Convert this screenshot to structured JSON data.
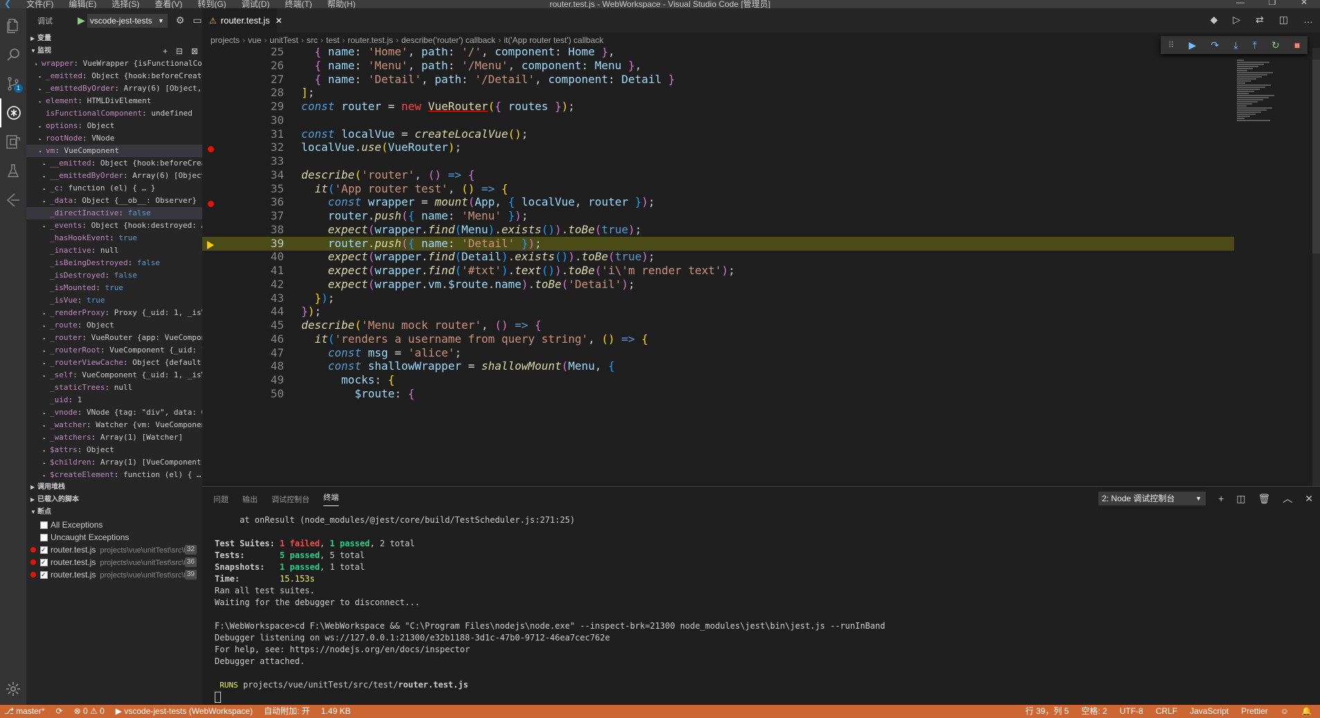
{
  "titlebar": {
    "menus": [
      "文件(F)",
      "编辑(E)",
      "选择(S)",
      "查看(V)",
      "转到(G)",
      "调试(D)",
      "终端(T)",
      "帮助(H)"
    ],
    "title": "router.test.js - WebWorkspace - Visual Studio Code [管理员]"
  },
  "activity": {
    "badge": "1"
  },
  "debug": {
    "label": "调试",
    "config": "vscode-jest-tests"
  },
  "sidebar": {
    "sec_variables": "变量",
    "sec_watch": "监视",
    "sec_callstack": "调用堆栈",
    "sec_scripts": "已载入的脚本",
    "sec_breakpoints": "断点",
    "watch": [
      {
        "t": "▾",
        "ind": 0,
        "k": "wrapper",
        "v": "VueWrapper {isFunctionalCompo…",
        "c": "v"
      },
      {
        "t": "▸",
        "ind": 1,
        "k": "_emitted",
        "v": "Object {hook:beforeCreate: …",
        "c": "v"
      },
      {
        "t": "▸",
        "ind": 1,
        "k": "_emittedByOrder",
        "v": "Array(6) [Object, Ob…",
        "c": "v"
      },
      {
        "t": "▸",
        "ind": 1,
        "k": "element",
        "v": "HTMLDivElement",
        "c": "v"
      },
      {
        "t": "",
        "ind": 1,
        "k": "isFunctionalComponent",
        "v": "undefined",
        "c": "v"
      },
      {
        "t": "▸",
        "ind": 1,
        "k": "options",
        "v": "Object",
        "c": "v"
      },
      {
        "t": "▸",
        "ind": 1,
        "k": "rootNode",
        "v": "VNode",
        "c": "v"
      },
      {
        "t": "▾",
        "ind": 1,
        "k": "vm",
        "v": "VueComponent",
        "c": "v",
        "sel": "vm"
      },
      {
        "t": "▸",
        "ind": 2,
        "k": "__emitted",
        "v": "Object {hook:beforeCreat…",
        "c": "v"
      },
      {
        "t": "▸",
        "ind": 2,
        "k": "__emittedByOrder",
        "v": "Array(6) [Object,…",
        "c": "v"
      },
      {
        "t": "▸",
        "ind": 2,
        "k": "_c",
        "v": "function (el) { … }",
        "c": "v"
      },
      {
        "t": "▸",
        "ind": 2,
        "k": "_data",
        "v": "Object {__ob__: Observer}",
        "c": "v"
      },
      {
        "t": "",
        "ind": 2,
        "k": "_directInactive",
        "v": "false",
        "c": "vb",
        "sel": "hl"
      },
      {
        "t": "▸",
        "ind": 2,
        "k": "_events",
        "v": "Object {hook:destroyed: Ar…",
        "c": "v"
      },
      {
        "t": "",
        "ind": 2,
        "k": "_hasHookEvent",
        "v": "true",
        "c": "vb"
      },
      {
        "t": "",
        "ind": 2,
        "k": "_inactive",
        "v": "null",
        "c": "v"
      },
      {
        "t": "",
        "ind": 2,
        "k": "_isBeingDestroyed",
        "v": "false",
        "c": "vb"
      },
      {
        "t": "",
        "ind": 2,
        "k": "_isDestroyed",
        "v": "false",
        "c": "vb"
      },
      {
        "t": "",
        "ind": 2,
        "k": "_isMounted",
        "v": "true",
        "c": "vb"
      },
      {
        "t": "",
        "ind": 2,
        "k": "_isVue",
        "v": "true",
        "c": "vb"
      },
      {
        "t": "▸",
        "ind": 2,
        "k": "_renderProxy",
        "v": "Proxy {_uid: 1, _isVu…",
        "c": "v"
      },
      {
        "t": "▸",
        "ind": 2,
        "k": "_route",
        "v": "Object",
        "c": "v"
      },
      {
        "t": "▸",
        "ind": 2,
        "k": "_router",
        "v": "VueRouter {app: VueCompone…",
        "c": "v"
      },
      {
        "t": "▸",
        "ind": 2,
        "k": "_routerRoot",
        "v": "VueComponent {_uid: 1,…",
        "c": "v"
      },
      {
        "t": "▸",
        "ind": 2,
        "k": "_routerViewCache",
        "v": "Object {default: …",
        "c": "v"
      },
      {
        "t": "▸",
        "ind": 2,
        "k": "_self",
        "v": "VueComponent {_uid: 1, _isVu…",
        "c": "v"
      },
      {
        "t": "",
        "ind": 2,
        "k": "_staticTrees",
        "v": "null",
        "c": "v"
      },
      {
        "t": "",
        "ind": 2,
        "k": "_uid",
        "v": "1",
        "c": "vn"
      },
      {
        "t": "▸",
        "ind": 2,
        "k": "_vnode",
        "v": "VNode {tag: \"div\", data: Ob…",
        "c": "v"
      },
      {
        "t": "▸",
        "ind": 2,
        "k": "_watcher",
        "v": "Watcher {vm: VueComponent…",
        "c": "v"
      },
      {
        "t": "▸",
        "ind": 2,
        "k": "_watchers",
        "v": "Array(1) [Watcher]",
        "c": "v"
      },
      {
        "t": "▸",
        "ind": 2,
        "k": "$attrs",
        "v": "Object",
        "c": "v"
      },
      {
        "t": "▸",
        "ind": 2,
        "k": "$children",
        "v": "Array(1) [VueComponent]",
        "c": "v"
      },
      {
        "t": "▸",
        "ind": 2,
        "k": "$createElement",
        "v": "function (el) { … }",
        "c": "v"
      }
    ],
    "breakpoints": [
      {
        "label": "All Exceptions",
        "checked": false
      },
      {
        "label": "Uncaught Exceptions",
        "checked": false
      },
      {
        "label": "router.test.js",
        "path": "projects\\vue\\unitTest\\src\\t…",
        "line": "32",
        "checked": true
      },
      {
        "label": "router.test.js",
        "path": "projects\\vue\\unitTest\\src\\t…",
        "line": "36",
        "checked": true
      },
      {
        "label": "router.test.js",
        "path": "projects\\vue\\unitTest\\src\\t…",
        "line": "39",
        "checked": true
      }
    ]
  },
  "editor": {
    "tab_label": "router.test.js",
    "breadcrumb": [
      "projects",
      "vue",
      "unitTest",
      "src",
      "test",
      "router.test.js",
      "describe('router') callback",
      "it('App router test') callback"
    ],
    "lines": [
      {
        "n": "25",
        "h": "  <span class=\"pu\">{</span> <span class=\"var\">name</span>: <span class=\"str\">'Home'</span>, <span class=\"var\">path</span>: <span class=\"str\">'/'</span>, <span class=\"var\">component</span>: <span class=\"var\">Home</span> <span class=\"pu\">}</span>,"
      },
      {
        "n": "26",
        "h": "  <span class=\"pu\">{</span> <span class=\"var\">name</span>: <span class=\"str\">'Menu'</span>, <span class=\"var\">path</span>: <span class=\"str\">'/Menu'</span>, <span class=\"var\">component</span>: <span class=\"var\">Menu</span> <span class=\"pu\">}</span>,"
      },
      {
        "n": "27",
        "h": "  <span class=\"pu\">{</span> <span class=\"var\">name</span>: <span class=\"str\">'Detail'</span>, <span class=\"var\">path</span>: <span class=\"str\">'/Detail'</span>, <span class=\"var\">component</span>: <span class=\"var\">Detail</span> <span class=\"pu\">}</span>"
      },
      {
        "n": "28",
        "h": "<span class=\"bu\">]</span>;"
      },
      {
        "n": "29",
        "h": "<span class=\"kw\">const</span> <span class=\"var\">router</span> <span class=\"op\">=</span> <span class=\"new\">new</span> <span class=\"fnu\">VueRouter</span><span class=\"bu\">(</span><span class=\"pu\">{</span> <span class=\"var\">routes</span> <span class=\"pu\">}</span><span class=\"bu\">)</span>;"
      },
      {
        "n": "30",
        "h": ""
      },
      {
        "n": "31",
        "h": "<span class=\"kw\">const</span> <span class=\"var\">localVue</span> <span class=\"op\">=</span> <span class=\"fn\">createLocalVue</span><span class=\"bu\">()</span>;"
      },
      {
        "n": "32",
        "h": "<span class=\"var\">localVue</span>.<span class=\"fn\">use</span><span class=\"bu\">(</span><span class=\"var\">VueRouter</span><span class=\"bu\">)</span>;",
        "bp": true
      },
      {
        "n": "33",
        "h": ""
      },
      {
        "n": "34",
        "h": "<span class=\"fn\">describe</span><span class=\"bu\">(</span><span class=\"str\">'router'</span>, <span class=\"pu\">()</span> <span class=\"kw2\">=&gt;</span> <span class=\"pu\">{</span>"
      },
      {
        "n": "35",
        "h": "  <span class=\"fn\">it</span><span class=\"bl\">(</span><span class=\"str\">'App router test'</span>, <span class=\"bu\">()</span> <span class=\"kw2\">=&gt;</span> <span class=\"bu\">{</span>"
      },
      {
        "n": "36",
        "h": "    <span class=\"kw\">const</span> <span class=\"var\">wrapper</span> <span class=\"op\">=</span> <span class=\"fn\">mount</span><span class=\"pu\">(</span><span class=\"var\">App</span>, <span class=\"bl\">{</span> <span class=\"var\">localVue</span>, <span class=\"var\">router</span> <span class=\"bl\">}</span><span class=\"pu\">)</span>;",
        "bp": true
      },
      {
        "n": "37",
        "h": "    <span class=\"var\">router</span>.<span class=\"fn\">push</span><span class=\"pu\">(</span><span class=\"bl\">{</span> <span class=\"var\">name</span>: <span class=\"str\">'Menu'</span> <span class=\"bl\">}</span><span class=\"pu\">)</span>;"
      },
      {
        "n": "38",
        "h": "    <span class=\"fn\">expect</span><span class=\"pu\">(</span><span class=\"var\">wrapper</span>.<span class=\"fn\">find</span><span class=\"bl\">(</span><span class=\"var\">Menu</span><span class=\"bl\">)</span>.<span class=\"fn\">exists</span><span class=\"bl\">()</span><span class=\"pu\">)</span>.<span class=\"fn\">toBe</span><span class=\"pu\">(</span><span class=\"kw2\">true</span><span class=\"pu\">)</span>;"
      },
      {
        "n": "39",
        "h": "    <span class=\"var\">router</span>.<span class=\"fn\">push</span><span class=\"pu\">(</span><span class=\"bl\">{</span> <span class=\"var\">name</span>: <span class=\"str\">'Detail'</span> <span class=\"bl\">}</span><span class=\"pu\">)</span>;",
        "cur": true
      },
      {
        "n": "40",
        "h": "    <span class=\"fn\">expect</span><span class=\"pu\">(</span><span class=\"var\">wrapper</span>.<span class=\"fn\">find</span><span class=\"bl\">(</span><span class=\"var\">Detail</span><span class=\"bl\">)</span>.<span class=\"fn\">exists</span><span class=\"bl\">()</span><span class=\"pu\">)</span>.<span class=\"fn\">toBe</span><span class=\"pu\">(</span><span class=\"kw2\">true</span><span class=\"pu\">)</span>;"
      },
      {
        "n": "41",
        "h": "    <span class=\"fn\">expect</span><span class=\"pu\">(</span><span class=\"var\">wrapper</span>.<span class=\"fn\">find</span><span class=\"bl\">(</span><span class=\"str\">'#txt'</span><span class=\"bl\">)</span>.<span class=\"fn\">text</span><span class=\"bl\">()</span><span class=\"pu\">)</span>.<span class=\"fn\">toBe</span><span class=\"pu\">(</span><span class=\"str\">'i\\'m render text'</span><span class=\"pu\">)</span>;"
      },
      {
        "n": "42",
        "h": "    <span class=\"fn\">expect</span><span class=\"pu\">(</span><span class=\"var\">wrapper</span>.<span class=\"var\">vm</span>.<span class=\"var\">$route</span>.<span class=\"var\">name</span><span class=\"pu\">)</span>.<span class=\"fn\">toBe</span><span class=\"pu\">(</span><span class=\"str\">'Detail'</span><span class=\"pu\">)</span>;"
      },
      {
        "n": "43",
        "h": "  <span class=\"bu\">}</span><span class=\"bl\">)</span>;"
      },
      {
        "n": "44",
        "h": "<span class=\"pu\">}</span><span class=\"bu\">)</span>;"
      },
      {
        "n": "45",
        "h": "<span class=\"fn\">describe</span><span class=\"bu\">(</span><span class=\"str\">'Menu mock router'</span>, <span class=\"pu\">()</span> <span class=\"kw2\">=&gt;</span> <span class=\"pu\">{</span>"
      },
      {
        "n": "46",
        "h": "  <span class=\"fn\">it</span><span class=\"bl\">(</span><span class=\"str\">'renders a username from query string'</span>, <span class=\"bu\">()</span> <span class=\"kw2\">=&gt;</span> <span class=\"bu\">{</span>"
      },
      {
        "n": "47",
        "h": "    <span class=\"kw\">const</span> <span class=\"var\">msg</span> <span class=\"op\">=</span> <span class=\"str\">'alice'</span>;"
      },
      {
        "n": "48",
        "h": "    <span class=\"kw\">const</span> <span class=\"var\">shallowWrapper</span> <span class=\"op\">=</span> <span class=\"fn\">shallowMount</span><span class=\"pu\">(</span><span class=\"var\">Menu</span>, <span class=\"bl\">{</span>"
      },
      {
        "n": "49",
        "h": "      <span class=\"var\">mocks</span>: <span class=\"bu\">{</span>"
      },
      {
        "n": "50",
        "h": "        <span class=\"var\">$route</span>: <span class=\"pu\">{</span>"
      }
    ]
  },
  "panel": {
    "tabs": [
      "问题",
      "输出",
      "调试控制台",
      "终端"
    ],
    "select": "2: Node 调试控制台"
  },
  "terminal": {
    "l1": "     at onResult (node_modules/@jest/core/build/TestScheduler.js:271:25)",
    "suites_label": "Test Suites: ",
    "suites_failed": "1 failed",
    "suites_passed": "1 passed",
    "suites_total": ", 2 total",
    "tests_label": "Tests:       ",
    "tests_passed": "5 passed",
    "tests_total": ", 5 total",
    "snap_label": "Snapshots:   ",
    "snap_passed": "1 passed",
    "snap_total": ", 1 total",
    "time_label": "Time:        ",
    "time_val": "15.153s",
    "ran": "Ran all test suites.",
    "waiting": "Waiting for the debugger to disconnect...",
    "cmd": "F:\\WebWorkspace>cd F:\\WebWorkspace && \"C:\\Program Files\\nodejs\\node.exe\" --inspect-brk=21300 node_modules\\jest\\bin\\jest.js --runInBand",
    "listen": "Debugger listening on ws://127.0.0.1:21300/e32b1188-3d1c-47b0-9712-46ea7cec762e",
    "help": "For help, see: https://nodejs.org/en/docs/inspector",
    "attached": "Debugger attached.",
    "runs": "RUNS",
    "runs_path_prefix": " projects/vue/unitTest/src/test/",
    "runs_file": "router.test.js"
  },
  "status": {
    "branch": "master*",
    "errors": "0",
    "warnings": "0",
    "debug": "vscode-jest-tests (WebWorkspace)",
    "autoattach": "自动附加: 开",
    "size": "1.49 KB",
    "position": "行 39，列 5",
    "spaces": "空格: 2",
    "encoding": "UTF-8",
    "eol": "CRLF",
    "lang": "JavaScript",
    "prettier": "Prettier"
  },
  "colors": {
    "statusbar": "#cc6633",
    "current_line": "#4b4b18",
    "breakpoint": "#e51400"
  }
}
